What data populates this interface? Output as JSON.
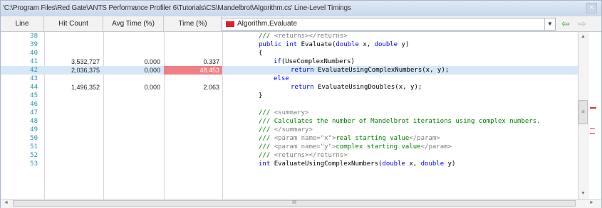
{
  "titlebar": {
    "path": "'C:\\Program Files\\Red Gate\\ANTS Performance Profiler 6\\Tutorials\\CS\\Mandelbrot\\Algorithm.cs' Line-Level Timings",
    "close_glyph": "×"
  },
  "columns": {
    "line": "Line",
    "hit_count": "Hit Count",
    "avg_time": "Avg Time (%)",
    "time": "Time (%)"
  },
  "method_selector": {
    "value": "Algorithm.Evaluate",
    "swatch_color": "#d9232a",
    "arrow": "▼"
  },
  "nav": {
    "back": "⇦",
    "forward": "⇨"
  },
  "rows": [
    {
      "line": "38",
      "hit": "",
      "avg": "",
      "time": ""
    },
    {
      "line": "39",
      "hit": "",
      "avg": "",
      "time": ""
    },
    {
      "line": "40",
      "hit": "",
      "avg": "",
      "time": ""
    },
    {
      "line": "41",
      "hit": "3,532,727",
      "avg": "0.000",
      "time": "0.337"
    },
    {
      "line": "42",
      "hit": "2,036,375",
      "avg": "0.000",
      "time": "48.453"
    },
    {
      "line": "43",
      "hit": "",
      "avg": "",
      "time": ""
    },
    {
      "line": "44",
      "hit": "1,496,352",
      "avg": "0.000",
      "time": "2.063"
    },
    {
      "line": "45",
      "hit": "",
      "avg": "",
      "time": ""
    },
    {
      "line": "46",
      "hit": "",
      "avg": "",
      "time": ""
    },
    {
      "line": "47",
      "hit": "",
      "avg": "",
      "time": ""
    },
    {
      "line": "48",
      "hit": "",
      "avg": "",
      "time": ""
    },
    {
      "line": "49",
      "hit": "",
      "avg": "",
      "time": ""
    },
    {
      "line": "50",
      "hit": "",
      "avg": "",
      "time": ""
    },
    {
      "line": "51",
      "hit": "",
      "avg": "",
      "time": ""
    },
    {
      "line": "52",
      "hit": "",
      "avg": "",
      "time": ""
    },
    {
      "line": "53",
      "hit": "",
      "avg": "",
      "time": ""
    }
  ],
  "code": {
    "l38_doc": "/// ",
    "l38_tag": "<returns></returns>",
    "l39_public": "public int ",
    "l39_rest": "Evaluate(",
    "l39_double1": "double",
    "l39_x": " x, ",
    "l39_double2": "double",
    "l39_y": " y)",
    "l40": "{",
    "l41_if": "if",
    "l41_rest": "(UseComplexNumbers)",
    "l42_return": "return ",
    "l42_rest": "EvaluateUsingComplexNumbers(x, y);",
    "l43_else": "else",
    "l44_return": "return ",
    "l44_rest": "EvaluateUsingDoubles(x, y);",
    "l45": "}",
    "l47_doc": "/// ",
    "l47_tag": "<summary>",
    "l48_doc": "/// ",
    "l48_text": "Calculates the number of Mandelbrot iterations using complex numbers.",
    "l49_doc": "/// ",
    "l49_tag": "</summary>",
    "l50_doc": "/// ",
    "l50_tag1": "<param name=\"x\">",
    "l50_text": "real starting value",
    "l50_tag2": "</param>",
    "l51_doc": "/// ",
    "l51_tag1": "<param name=\"y\">",
    "l51_text": "complex starting value",
    "l51_tag2": "</param>",
    "l52_doc": "/// ",
    "l52_tag": "<returns></returns>",
    "l53_int": "int ",
    "l53_rest": "EvaluateUsingComplexNumbers(",
    "l53_double1": "double",
    "l53_x": " x, ",
    "l53_double2": "double",
    "l53_y": " y)"
  },
  "scrollbars": {
    "up": "▲",
    "down": "▼",
    "left": "◄",
    "right": "►",
    "v_grip": "≡",
    "h_grip": "III"
  },
  "colors": {
    "hot_time": "#ef7f84",
    "highlight_row": "#d6e8f8",
    "marker": "#e03030"
  }
}
